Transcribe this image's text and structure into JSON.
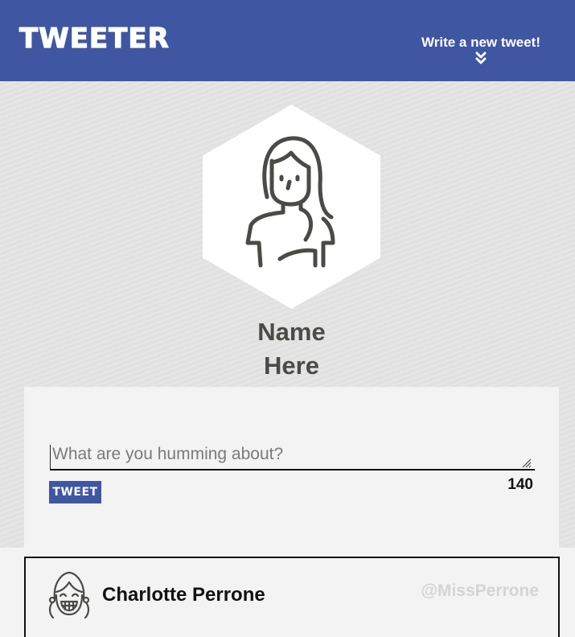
{
  "header": {
    "logo": "TWEETER",
    "write_link": "Write a new tweet!",
    "write_icon": "double-chevron-down-icon"
  },
  "profile": {
    "avatar_icon": "female-avatar-icon",
    "name_line1": "Name",
    "name_line2": "Here"
  },
  "compose": {
    "placeholder": "What are you humming about?",
    "value": "",
    "button_label": "TWEET",
    "char_count": "140"
  },
  "feed": {
    "items": [
      {
        "avatar_icon": "smiling-girl-avatar-icon",
        "name": "Charlotte Perrone",
        "handle": "@MissPerrone"
      }
    ]
  },
  "colors": {
    "brand": "#3f56a3",
    "background": "#e1e1e1",
    "panel": "#f3f3f3",
    "text_dark": "#4a4a47"
  }
}
